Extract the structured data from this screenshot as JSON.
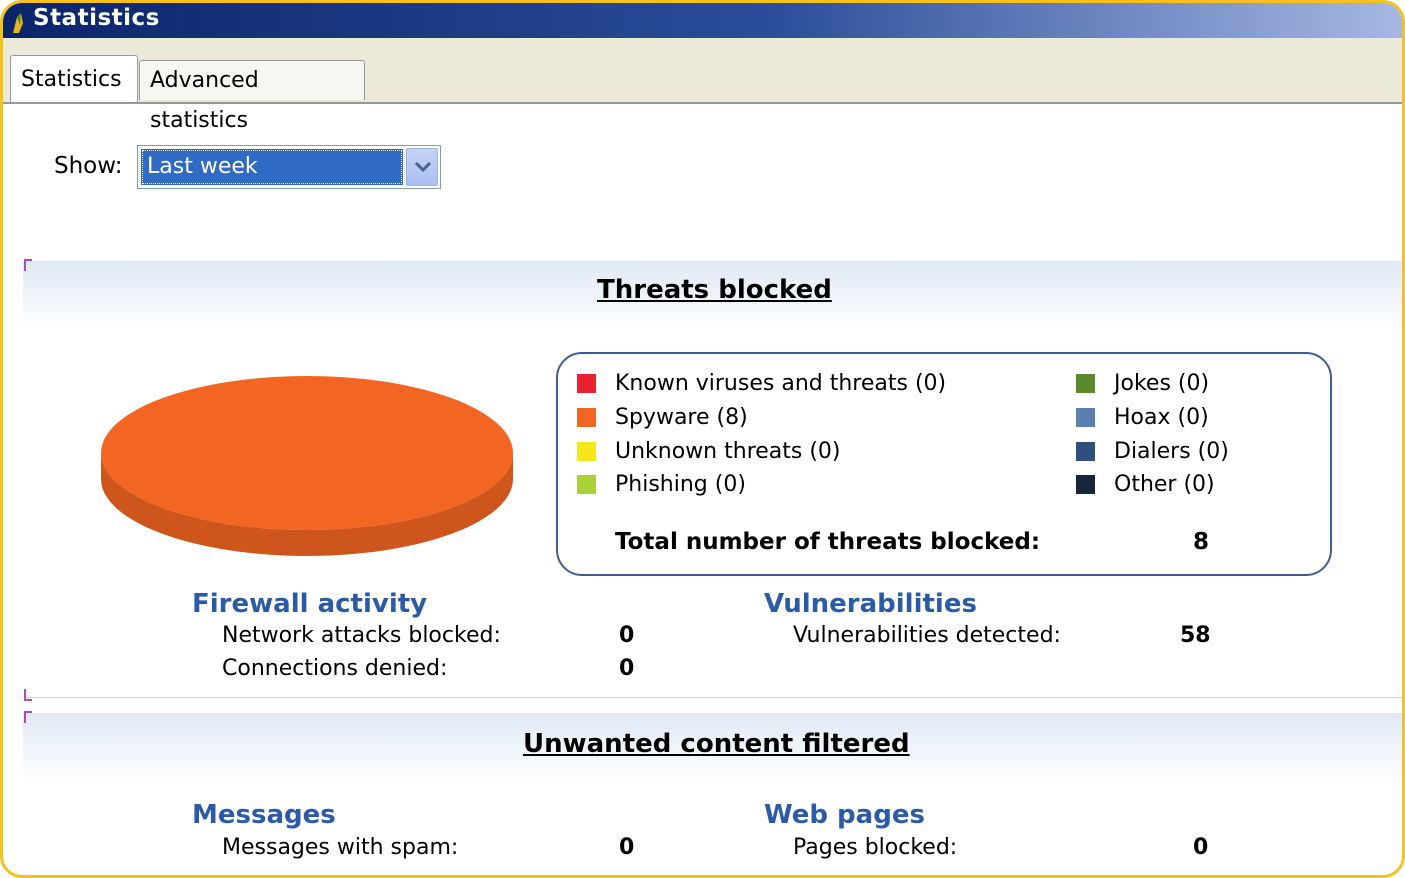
{
  "window": {
    "title": "Statistics"
  },
  "tabs": [
    {
      "label": "Statistics",
      "active": true
    },
    {
      "label": "Advanced statistics",
      "active": false
    }
  ],
  "filter": {
    "label": "Show:",
    "selected": "Last week"
  },
  "threats_section": {
    "title": "Threats blocked",
    "legend": [
      {
        "label": "Known viruses and threats (0)",
        "color": "#e8232f"
      },
      {
        "label": "Spyware (8)",
        "color": "#f26522"
      },
      {
        "label": "Unknown threats (0)",
        "color": "#f6e71a"
      },
      {
        "label": "Phishing (0)",
        "color": "#a8d13a"
      },
      {
        "label": "Jokes (0)",
        "color": "#5a8a2c"
      },
      {
        "label": "Hoax (0)",
        "color": "#5b7fae"
      },
      {
        "label": "Dialers (0)",
        "color": "#2e4f7f"
      },
      {
        "label": "Other (0)",
        "color": "#15263c"
      }
    ],
    "total_label": "Total number of threats blocked:",
    "total_value": "8"
  },
  "chart_data": {
    "type": "pie",
    "slices": [
      {
        "label": "Known viruses and threats",
        "value": 0,
        "color": "#e8232f"
      },
      {
        "label": "Spyware",
        "value": 8,
        "color": "#f26522"
      },
      {
        "label": "Unknown threats",
        "value": 0,
        "color": "#f6e71a"
      },
      {
        "label": "Phishing",
        "value": 0,
        "color": "#a8d13a"
      },
      {
        "label": "Jokes",
        "value": 0,
        "color": "#5a8a2c"
      },
      {
        "label": "Hoax",
        "value": 0,
        "color": "#5b7fae"
      },
      {
        "label": "Dialers",
        "value": 0,
        "color": "#2e4f7f"
      },
      {
        "label": "Other",
        "value": 0,
        "color": "#15263c"
      }
    ]
  },
  "firewall": {
    "title": "Firewall activity",
    "rows": [
      {
        "label": "Network attacks blocked:",
        "value": "0"
      },
      {
        "label": "Connections denied:",
        "value": "0"
      }
    ]
  },
  "vulnerabilities": {
    "title": "Vulnerabilities",
    "rows": [
      {
        "label": "Vulnerabilities detected:",
        "value": "58"
      }
    ]
  },
  "content_section": {
    "title": "Unwanted content filtered"
  },
  "messages": {
    "title": "Messages",
    "rows": [
      {
        "label": "Messages with spam:",
        "value": "0"
      }
    ]
  },
  "web_pages": {
    "title": "Web pages",
    "rows": [
      {
        "label": "Pages blocked:",
        "value": "0"
      }
    ]
  }
}
